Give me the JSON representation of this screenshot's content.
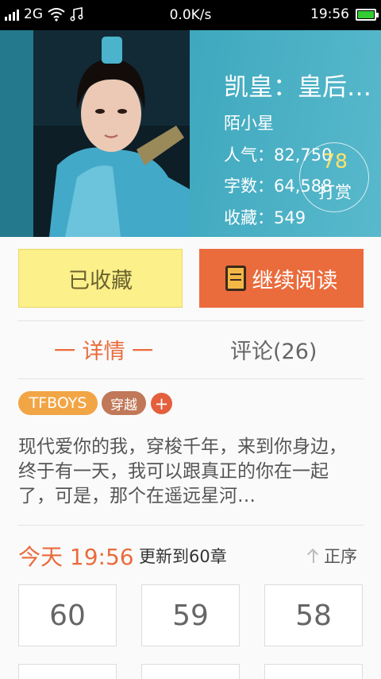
{
  "status_bar": {
    "network": "2G",
    "speed": "0.0K/s",
    "time": "19:56",
    "icons": [
      "signal-icon",
      "wifi-icon",
      "music-icon",
      "battery-icon"
    ]
  },
  "book": {
    "title": "凯皇：皇后…",
    "author": "陌小星",
    "popularity": "人气：82,750",
    "word_count": "字数：64,588",
    "favorites": "收藏：549",
    "reward": {
      "count": "78",
      "label": "打赏"
    }
  },
  "actions": {
    "favorite_label": "已收藏",
    "read_label": "继续阅读",
    "read_icon": "book-icon"
  },
  "tabs": {
    "detail": "一 详情 一",
    "comment": "评论(26)"
  },
  "tags": {
    "items": [
      "TFBOYS",
      "穿越"
    ],
    "add": "+"
  },
  "description": "现代爱你的我，穿梭千年，来到你身边，终于有一天，我可以跟真正的你在一起了，可是，那个在遥远星河…",
  "update": {
    "time": "今天 19:56",
    "text": "更新到60章",
    "sort_label": "正序"
  },
  "chapters": [
    "60",
    "59",
    "58"
  ],
  "colors": {
    "accent": "#ea6b3c",
    "favorite_bg": "#fbf08a",
    "hero_bg": "#3ea8be"
  }
}
